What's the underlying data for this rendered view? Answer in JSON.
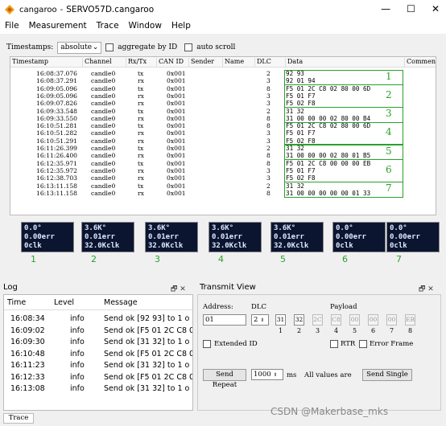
{
  "window": {
    "app": "cangaroo",
    "title": "SERVO57D.cangaroo",
    "controls": [
      "—",
      "☐",
      "✕"
    ]
  },
  "menu": [
    "File",
    "Measurement",
    "Trace",
    "Window",
    "Help"
  ],
  "toolbar": {
    "timestamps_label": "Timestamps:",
    "timestamps_value": "absolute",
    "aggregate_label": "aggregate by ID",
    "autoscroll_label": "auto scroll"
  },
  "trace": {
    "columns": [
      "Timestamp",
      "Channel",
      "Rx/Tx",
      "CAN ID",
      "Sender",
      "Name",
      "DLC",
      "Data",
      "Comment"
    ],
    "rows": [
      [
        "16:08:37.076",
        "candle0",
        "tx",
        "0x001",
        "2",
        "92 93"
      ],
      [
        "16:08:37.291",
        "candle0",
        "rx",
        "0x001",
        "3",
        "92 01 94"
      ],
      [
        "16:09:05.096",
        "candle0",
        "tx",
        "0x001",
        "8",
        "F5 01 2C C8 02 80 00 6D"
      ],
      [
        "16:09:05.096",
        "candle0",
        "rx",
        "0x001",
        "3",
        "F5 01 F7"
      ],
      [
        "16:09:07.826",
        "candle0",
        "rx",
        "0x001",
        "3",
        "F5 02 F8"
      ],
      [
        "16:09:33.548",
        "candle0",
        "tx",
        "0x001",
        "2",
        "31 32"
      ],
      [
        "16:09:33.550",
        "candle0",
        "rx",
        "0x001",
        "8",
        "31 00 00 00 02 80 00 B4"
      ],
      [
        "16:10:51.281",
        "candle0",
        "tx",
        "0x001",
        "8",
        "F5 01 2C C8 02 80 00 6D"
      ],
      [
        "16:10:51.282",
        "candle0",
        "rx",
        "0x001",
        "3",
        "F5 01 F7"
      ],
      [
        "16:10:51.291",
        "candle0",
        "rx",
        "0x001",
        "3",
        "F5 02 F8"
      ],
      [
        "16:11:26.399",
        "candle0",
        "tx",
        "0x001",
        "2",
        "31 32"
      ],
      [
        "16:11:26.400",
        "candle0",
        "rx",
        "0x001",
        "8",
        "31 00 00 00 02 80 01 B5"
      ],
      [
        "16:12:35.971",
        "candle0",
        "tx",
        "0x001",
        "8",
        "F5 01 2C C8 00 00 00 EB"
      ],
      [
        "16:12:35.972",
        "candle0",
        "rx",
        "0x001",
        "3",
        "F5 01 F7"
      ],
      [
        "16:12:38.703",
        "candle0",
        "rx",
        "0x001",
        "3",
        "F5 02 F8"
      ],
      [
        "16:13:11.158",
        "candle0",
        "tx",
        "0x001",
        "2",
        "31 32"
      ],
      [
        "16:13:11.158",
        "candle0",
        "rx",
        "0x001",
        "8",
        "31 00 00 00 00 00 01 33"
      ]
    ],
    "group_numbers": [
      "1",
      "2",
      "3",
      "4",
      "5",
      "6",
      "7"
    ]
  },
  "displays": [
    {
      "l1": "0.0°",
      "l2": "0.00err",
      "l3": "0clk",
      "num": "1"
    },
    {
      "l1": "3.6K°",
      "l2": "0.01err",
      "l3": "32.0Kclk",
      "num": "2"
    },
    {
      "l1": "3.6K°",
      "l2": "0.01err",
      "l3": "32.0Kclk",
      "num": "3"
    },
    {
      "l1": "3.6K°",
      "l2": "0.01err",
      "l3": "32.0Kclk",
      "num": "4"
    },
    {
      "l1": "3.6K°",
      "l2": "0.01err",
      "l3": "32.0Kclk",
      "num": "5"
    },
    {
      "l1": "0.0°",
      "l2": "0.00err",
      "l3": "0clk",
      "num": "6"
    },
    {
      "l1": "0.0°",
      "l2": "0.00err",
      "l3": "0clk",
      "num": "7"
    }
  ],
  "log": {
    "title": "Log",
    "controls": "🗗 ✕",
    "columns": [
      "Time",
      "Level",
      "Message"
    ],
    "rows": [
      [
        "16:08:34",
        "info",
        "Send ok [92 93] to 1 o"
      ],
      [
        "16:09:02",
        "info",
        "Send ok [F5 01 2C C8 0"
      ],
      [
        "16:09:30",
        "info",
        "Send ok [31 32] to 1 o"
      ],
      [
        "16:10:48",
        "info",
        "Send ok [F5 01 2C C8 0"
      ],
      [
        "16:11:23",
        "info",
        "Send ok [31 32] to 1 o"
      ],
      [
        "16:12:33",
        "info",
        "Send ok [F5 01 2C C8 0"
      ],
      [
        "16:13:08",
        "info",
        "Send ok [31 32] to 1 o"
      ]
    ]
  },
  "transmit": {
    "title": "Transmit View",
    "controls": "🗗 ✕",
    "address_label": "Address:",
    "address_value": "01",
    "dlc_label": "DLC",
    "dlc_value": "2",
    "payload_label": "Payload",
    "payload": [
      "31",
      "32",
      "2C",
      "C8",
      "00",
      "00",
      "00",
      "EB"
    ],
    "payload_indices": [
      "1",
      "2",
      "3",
      "4",
      "5",
      "6",
      "7",
      "8"
    ],
    "extended_label": "Extended ID",
    "rtr_label": "RTR",
    "error_label": "Error Frame",
    "send_repeat_label": "Send Repeat",
    "repeat_value": "1000",
    "ms_label": "ms",
    "all_values_label": "All values are",
    "send_single_label": "Send Single"
  },
  "status": {
    "trace_tab": "Trace",
    "watermark": "CSDN @Makerbase_mks"
  },
  "colors": {
    "accent_green": "#2aa12a",
    "display_bg": "#0b1530"
  }
}
